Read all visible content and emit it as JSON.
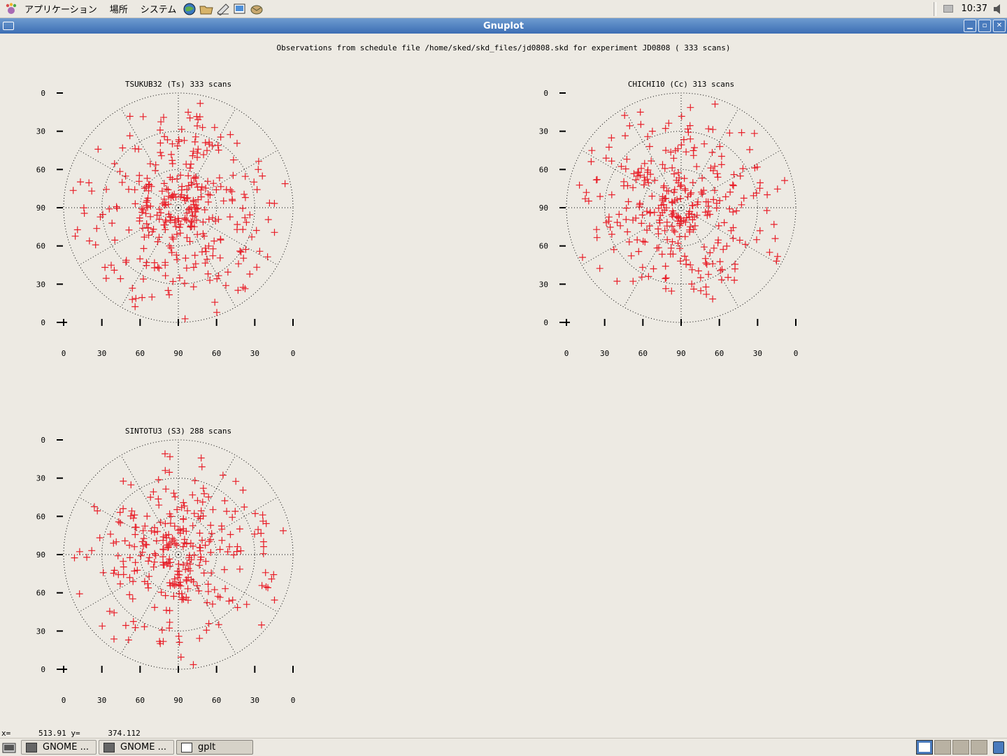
{
  "top_panel": {
    "menus": [
      "アプリケーション",
      "場所",
      "システム"
    ],
    "launchers": [
      "browser-icon",
      "file-manager-icon",
      "editor-icon",
      "paint-icon",
      "mail-icon"
    ],
    "clock": "10:37"
  },
  "window": {
    "title": "Gnuplot",
    "buttons": [
      "minimize-icon",
      "maximize-icon",
      "close-icon"
    ]
  },
  "plot": {
    "heading": "Observations from schedule file /home/sked/skd_files/jd0808.skd for experiment JD0808    ( 333 scans)",
    "marker_color": "#e8202a"
  },
  "chart_data": [
    {
      "type": "scatter",
      "title": "TSUKUB32 (Ts)  333 scans",
      "y_ticks": [
        "0",
        "30",
        "60",
        "90",
        "60",
        "30",
        "0"
      ],
      "x_ticks": [
        "0",
        "30",
        "60",
        "90",
        "60",
        "30",
        "0"
      ],
      "count": 333,
      "seed": 17,
      "gap": "none",
      "points": []
    },
    {
      "type": "scatter",
      "title": "CHICHI10 (Cc)  313 scans",
      "y_ticks": [
        "0",
        "30",
        "60",
        "90",
        "60",
        "30",
        "0"
      ],
      "x_ticks": [
        "0",
        "30",
        "60",
        "90",
        "60",
        "30",
        "0"
      ],
      "count": 313,
      "seed": 53,
      "gap": "south",
      "points": []
    },
    {
      "type": "scatter",
      "title": "SINTOTU3 (S3)  288 scans",
      "y_ticks": [
        "0",
        "30",
        "60",
        "90",
        "60",
        "30",
        "0"
      ],
      "x_ticks": [
        "0",
        "30",
        "60",
        "90",
        "60",
        "30",
        "0"
      ],
      "count": 288,
      "seed": 91,
      "gap": "none",
      "points": []
    }
  ],
  "status": {
    "x_label": "x=",
    "x_value": "513.91",
    "y_label": "y=",
    "y_value": "374.112"
  },
  "taskbar": {
    "tasks": [
      {
        "label": "GNOME ...",
        "icon": "terminal-icon"
      },
      {
        "label": "GNOME ...",
        "icon": "terminal-icon"
      },
      {
        "label": "gplt",
        "icon": "window-icon"
      }
    ]
  }
}
